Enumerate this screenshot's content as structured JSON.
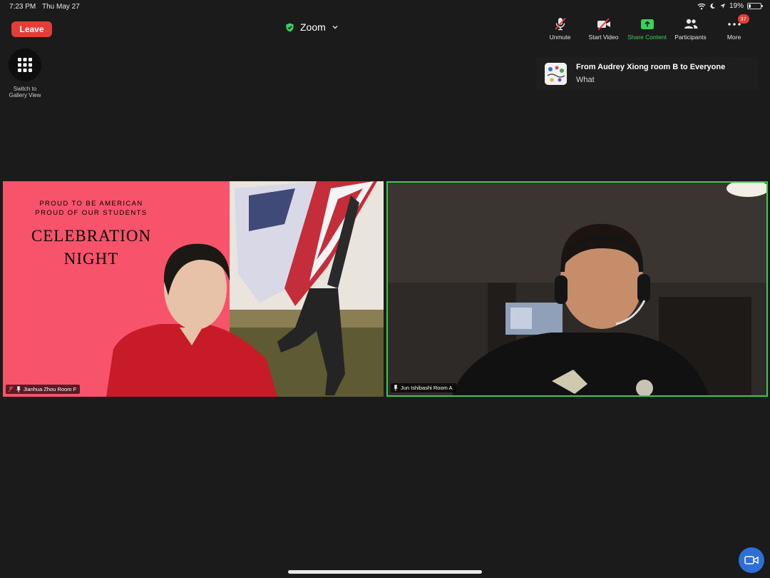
{
  "status_bar": {
    "time": "7:23 PM",
    "date": "Thu May 27",
    "battery_percent_label": "19%",
    "battery_level": 0.19
  },
  "header": {
    "leave_label": "Leave",
    "meeting_title": "Zoom"
  },
  "toolbar": {
    "unmute_label": "Unmute",
    "start_video_label": "Start Video",
    "share_content_label": "Share Content",
    "participants_label": "Participants",
    "more_label": "More",
    "more_badge": "37"
  },
  "gallery": {
    "label_line1": "Switch to",
    "label_line2": "Gallery View"
  },
  "chat_notification": {
    "from": "From Audrey Xiong room B to Everyone",
    "message": "What"
  },
  "videos": [
    {
      "name": "Jianhua Zhou Room F",
      "background_text": {
        "line1": "PROUD TO BE AMERICAN",
        "line2": "PROUD OF OUR STUDENTS",
        "headline1": "CELEBRATION",
        "headline2": "NIGHT"
      },
      "muted": true
    },
    {
      "name": "Jun Ishibashi Room A",
      "active_speaker": true
    }
  ],
  "colors": {
    "leave_red": "#e03e36",
    "share_green": "#3ccf5c",
    "active_speaker_border": "#3cc84a",
    "banner_pink": "#f7536a"
  }
}
